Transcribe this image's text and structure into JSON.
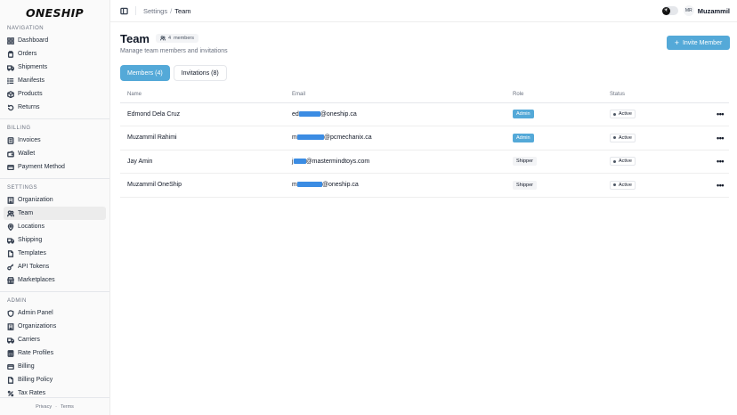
{
  "brand": {
    "logo_text": "ONESHIP"
  },
  "sidebar": {
    "sections": [
      {
        "label": "Navigation",
        "items": [
          {
            "label": "Dashboard",
            "icon": "grid-icon"
          },
          {
            "label": "Orders",
            "icon": "clipboard-icon"
          },
          {
            "label": "Shipments",
            "icon": "truck-icon"
          },
          {
            "label": "Manifests",
            "icon": "list-icon"
          },
          {
            "label": "Products",
            "icon": "box-icon"
          },
          {
            "label": "Returns",
            "icon": "return-icon"
          }
        ]
      },
      {
        "label": "Billing",
        "items": [
          {
            "label": "Invoices",
            "icon": "invoice-icon"
          },
          {
            "label": "Wallet",
            "icon": "wallet-icon"
          },
          {
            "label": "Payment Method",
            "icon": "card-icon"
          }
        ]
      },
      {
        "label": "Settings",
        "items": [
          {
            "label": "Organization",
            "icon": "building-icon"
          },
          {
            "label": "Team",
            "icon": "users-icon",
            "active": true
          },
          {
            "label": "Locations",
            "icon": "pin-icon"
          },
          {
            "label": "Shipping",
            "icon": "truck-icon"
          },
          {
            "label": "Templates",
            "icon": "file-icon"
          },
          {
            "label": "API Tokens",
            "icon": "key-icon"
          },
          {
            "label": "Marketplaces",
            "icon": "store-icon"
          }
        ]
      },
      {
        "label": "Admin",
        "items": [
          {
            "label": "Admin Panel",
            "icon": "shield-icon"
          },
          {
            "label": "Organizations",
            "icon": "building-icon"
          },
          {
            "label": "Carriers",
            "icon": "truck-icon"
          },
          {
            "label": "Rate Profiles",
            "icon": "calculator-icon"
          },
          {
            "label": "Billing",
            "icon": "card-icon"
          },
          {
            "label": "Billing Policy",
            "icon": "file-icon"
          },
          {
            "label": "Tax Rates",
            "icon": "percent-icon"
          }
        ]
      }
    ],
    "footer": {
      "privacy": "Privacy",
      "dot": "·",
      "terms": "Terms"
    }
  },
  "topbar": {
    "breadcrumb_parent": "Settings",
    "breadcrumb_sep": "/",
    "breadcrumb_current": "Team",
    "avatar_initials": "MR",
    "username": "Muzammil"
  },
  "page": {
    "title": "Team",
    "member_count": "4",
    "member_count_label": "members",
    "subtitle": "Manage team members and invitations",
    "invite_label": "Invite Member",
    "tabs": [
      {
        "label": "Members (4)",
        "active": true
      },
      {
        "label": "Invitations (8)",
        "active": false
      }
    ]
  },
  "table": {
    "columns": [
      "Name",
      "Email",
      "Role",
      "Status"
    ],
    "rows": [
      {
        "name": "Edmond Dela Cruz",
        "email_prefix": "ed",
        "email_suffix": "@oneship.ca",
        "role": "Admin",
        "status": "Active"
      },
      {
        "name": "Muzammil Rahimi",
        "email_prefix": "m",
        "email_suffix": "@pcmechanix.ca",
        "role": "Admin",
        "status": "Active"
      },
      {
        "name": "Jay Amin",
        "email_prefix": "j",
        "email_suffix": "@mastermindtoys.com",
        "role": "Shipper",
        "status": "Active"
      },
      {
        "name": "Muzammil OneShip",
        "email_prefix": "m",
        "email_suffix": "@oneship.ca",
        "role": "Shipper",
        "status": "Active"
      }
    ],
    "row_menu": "•••"
  },
  "colors": {
    "accent": "#54a9d8",
    "redaction": "#3b8ce3"
  }
}
